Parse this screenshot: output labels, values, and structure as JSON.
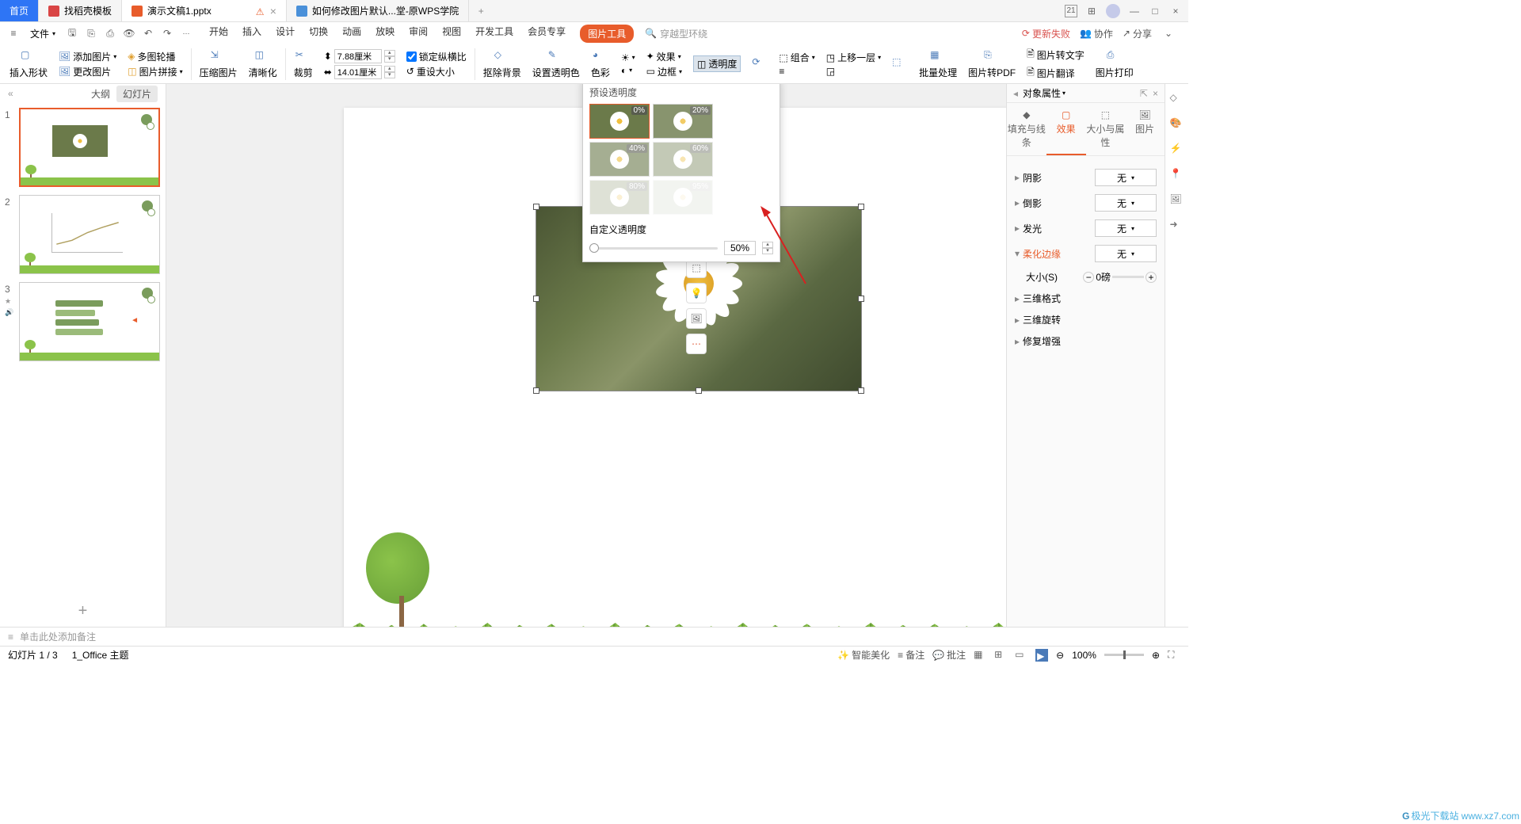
{
  "tabs": {
    "home": "首页",
    "t1": "找稻壳模板",
    "t2": "演示文稿1.pptx",
    "t3": "如何修改图片默认...堂-原WPS学院"
  },
  "titlebar_right": {
    "badge": "21"
  },
  "menu": {
    "file": "文件",
    "items": [
      "开始",
      "插入",
      "设计",
      "切换",
      "动画",
      "放映",
      "审阅",
      "视图",
      "开发工具",
      "会员专享",
      "图片工具"
    ],
    "active": 10,
    "search_placeholder": "穿越型环绕"
  },
  "menubar_right": {
    "update": "更新失败",
    "coop": "协作",
    "share": "分享"
  },
  "ribbon": {
    "insert_shape": "插入形状",
    "add_pic": "添加图片",
    "multi_outline": "多图轮播",
    "change_pic": "更改图片",
    "pic_join": "图片拼接",
    "compress": "压缩图片",
    "sharpen": "清晰化",
    "crop": "裁剪",
    "w": "7.88厘米",
    "h": "14.01厘米",
    "lock": "锁定纵横比",
    "reset": "重设大小",
    "remove_bg": "抠除背景",
    "set_trans": "设置透明色",
    "color": "色彩",
    "effect": "效果",
    "trans": "透明度",
    "border": "边框",
    "rotate": "旋转",
    "combine": "组合",
    "bring_fwd": "上移一层",
    "select": "选择",
    "batch": "批量处理",
    "to_pdf": "图片转PDF",
    "to_text": "图片转文字",
    "translate": "图片翻译",
    "print": "图片打印"
  },
  "slidepane": {
    "outline": "大纲",
    "slides": "幻灯片"
  },
  "popup": {
    "title": "预设透明度",
    "presets": [
      "0%",
      "20%",
      "40%",
      "60%",
      "80%",
      "95%"
    ],
    "custom": "自定义透明度",
    "value": "50%"
  },
  "right_panel": {
    "title": "对象属性",
    "tabs": [
      "填充与线条",
      "效果",
      "大小与属性",
      "图片"
    ],
    "active": 1,
    "shadow": "阴影",
    "reflection": "倒影",
    "glow": "发光",
    "soft_edge": "柔化边缘",
    "size": "大小(S)",
    "size_val": "0磅",
    "fmt3d": "三维格式",
    "rot3d": "三维旋转",
    "repair": "修复增强",
    "none": "无"
  },
  "notes": "单击此处添加备注",
  "status": {
    "slide": "幻灯片 1 / 3",
    "theme": "1_Office 主题",
    "beautify": "智能美化",
    "remark": "备注",
    "annotate": "批注",
    "zoom": "100%"
  },
  "watermark": "极光下载站 www.xz7.com"
}
